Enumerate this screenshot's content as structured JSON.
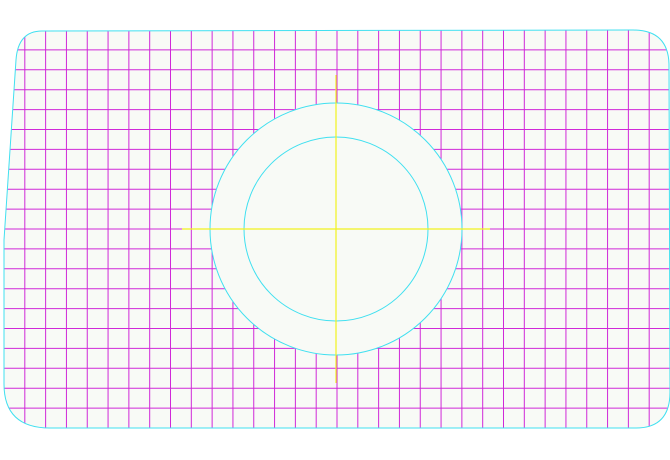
{
  "colors": {
    "background": "#ffffff",
    "fill": "#f8faf6",
    "outline": "#40e0f0",
    "grid": "#d028d8",
    "crosshair": "#f2f21e"
  },
  "grid": {
    "columns": 32,
    "rows": 20
  },
  "shapes": [
    "rounded-quadrilateral-outline",
    "outer-circle",
    "inner-circle",
    "crosshair"
  ]
}
